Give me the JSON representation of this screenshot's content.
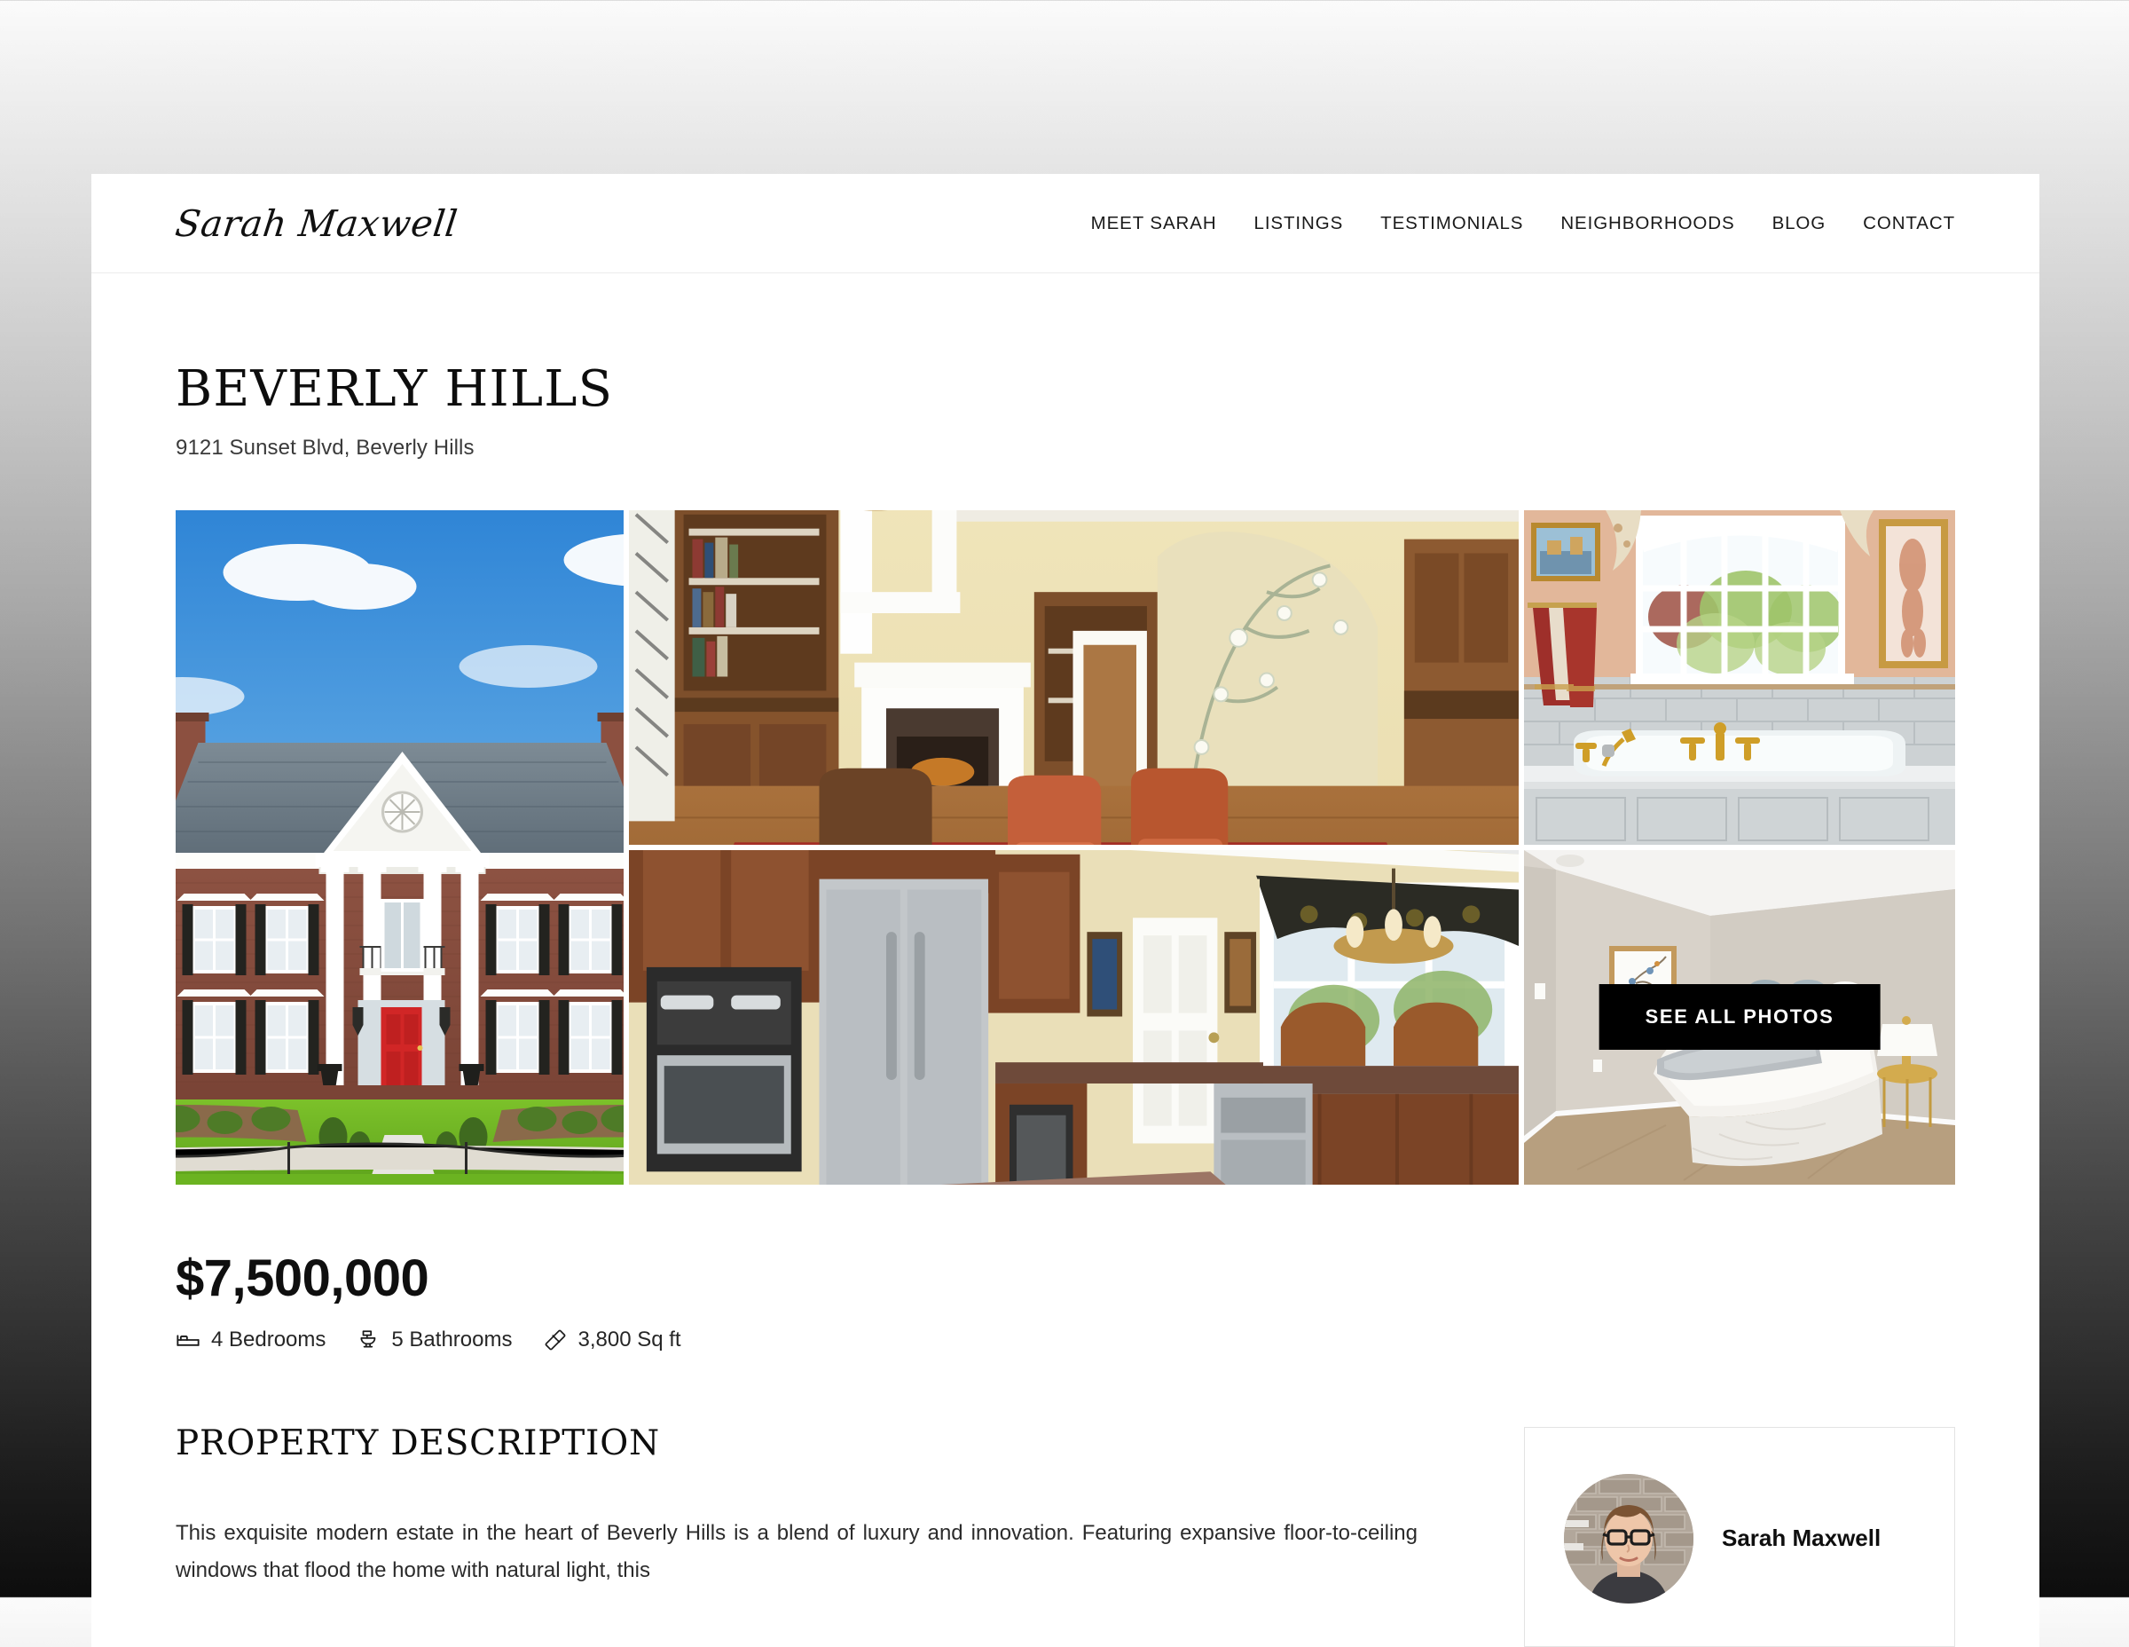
{
  "header": {
    "logo_text": "Sarah Maxwell",
    "nav": [
      {
        "label": "MEET SARAH"
      },
      {
        "label": "LISTINGS"
      },
      {
        "label": "TESTIMONIALS"
      },
      {
        "label": "NEIGHBORHOODS"
      },
      {
        "label": "BLOG"
      },
      {
        "label": "CONTACT"
      }
    ]
  },
  "listing": {
    "title": "BEVERLY HILLS",
    "address": "9121 Sunset Blvd, Beverly Hills",
    "price": "$7,500,000",
    "stats": [
      {
        "icon": "bed-icon",
        "label": "4 Bedrooms"
      },
      {
        "icon": "toilet-icon",
        "label": "5 Bathrooms"
      },
      {
        "icon": "ruler-icon",
        "label": "3,800 Sq ft"
      }
    ]
  },
  "gallery": {
    "see_all_photos_label": "SEE ALL PHOTOS",
    "tiles": [
      {
        "name": "living-room-photo",
        "alt": "Two-story living room with chandelier, fireplace, bookcases and floral sofa on a red Persian rug"
      },
      {
        "name": "exterior-front-photo",
        "alt": "Red brick colonial mansion with white columns and red front door on a green lawn"
      },
      {
        "name": "bathroom-photo",
        "alt": "Master bathroom with soaking tub, gold fixtures and arched window"
      },
      {
        "name": "kitchen-photo",
        "alt": "Kitchen with cherry cabinets, stainless steel appliances and granite island"
      },
      {
        "name": "bedroom-photo",
        "alt": "Neutral bedroom with gray and white bedding, framed art and gold nightstands"
      }
    ]
  },
  "description": {
    "heading": "PROPERTY DESCRIPTION",
    "body": "This exquisite modern estate in the heart of Beverly Hills is a blend of luxury and innovation. Featuring expansive floor-to-ceiling windows that flood the home with natural light, this"
  },
  "agent": {
    "name": "Sarah Maxwell"
  },
  "colors": {
    "accent": "#000000",
    "page_background": "#ffffff",
    "border": "#e3e3e3"
  }
}
